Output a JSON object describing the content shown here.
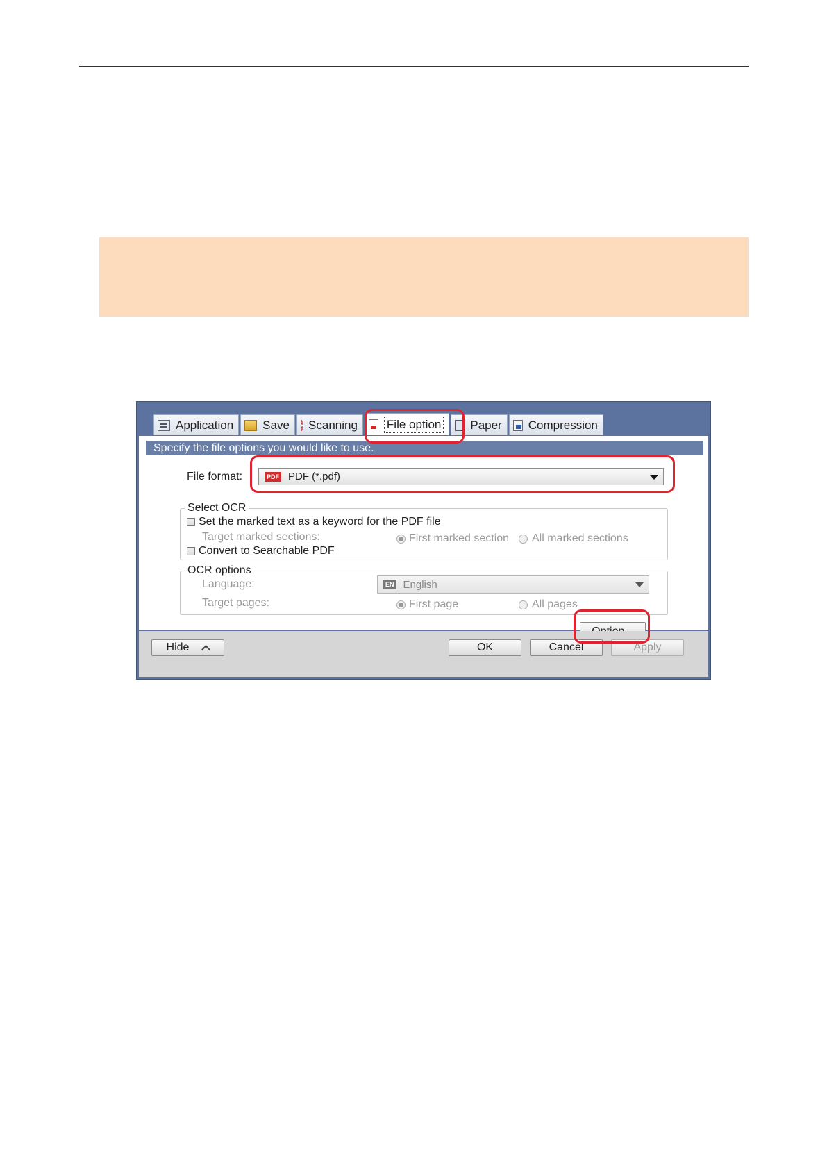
{
  "dialog": {
    "tabs": [
      {
        "label": "Application",
        "icon": "application-icon"
      },
      {
        "label": "Save",
        "icon": "save-folder-icon"
      },
      {
        "label": "Scanning",
        "icon": "scanning-icon"
      },
      {
        "label": "File option",
        "icon": "file-option-icon",
        "active": true
      },
      {
        "label": "Paper",
        "icon": "paper-icon"
      },
      {
        "label": "Compression",
        "icon": "compression-icon"
      }
    ],
    "header": "Specify the file options you would like to use.",
    "file_format": {
      "label": "File format:",
      "value": "PDF (*.pdf)",
      "badge": "PDF"
    },
    "select_ocr": {
      "title": "Select OCR",
      "keyword_checkbox": "Set the marked text as a keyword for the PDF file",
      "target_label": "Target marked sections:",
      "radio_first": "First marked section",
      "radio_all": "All marked sections",
      "searchable_checkbox": "Convert to Searchable PDF"
    },
    "ocr_options": {
      "title": "OCR options",
      "language_label": "Language:",
      "language_value": "English",
      "language_badge": "EN",
      "pages_label": "Target pages:",
      "radio_first": "First page",
      "radio_all": "All pages"
    },
    "option_button": "Option...",
    "footer": {
      "hide": "Hide",
      "ok": "OK",
      "cancel": "Cancel",
      "apply": "Apply"
    }
  },
  "colors": {
    "highlight": "#e0242f",
    "note_box": "#fddcbd",
    "dialog_frame": "#5d739f"
  }
}
